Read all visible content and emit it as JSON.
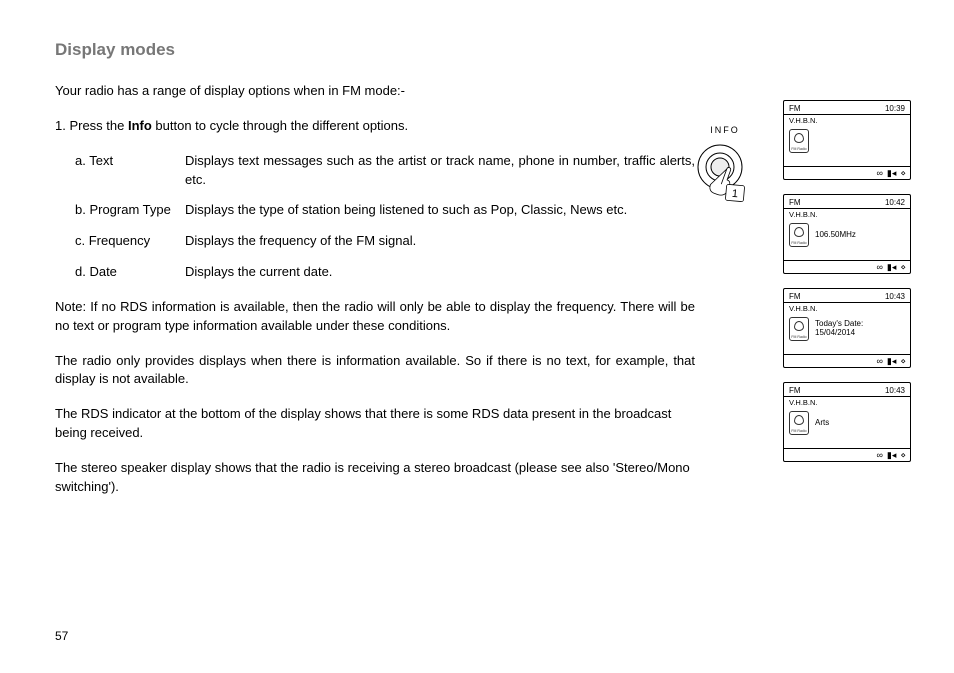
{
  "title": "Display modes",
  "intro": "Your radio has a range of display options when in FM mode:-",
  "instruction": {
    "prefix": "1. Press the ",
    "bold": "Info",
    "suffix": " button to cycle through the different options."
  },
  "options": [
    {
      "label": "a. Text",
      "desc": "Displays text messages such as the artist or track name, phone in number, traffic alerts, etc."
    },
    {
      "label": "b. Program Type",
      "desc": "Displays the type of station being listened to such as Pop, Classic, News etc."
    },
    {
      "label": "c. Frequency",
      "desc": "Displays the frequency of the FM signal."
    },
    {
      "label": "d. Date",
      "desc": "Displays the current date."
    }
  ],
  "notes": [
    "Note: If no RDS information is available, then the radio will only be able to display the frequency. There will be no text or program type information available under these conditions.",
    "The radio only provides displays when there is information available. So if there is no text, for example, that display is not available.",
    "The RDS indicator at the bottom of the display shows that there is some RDS data present in the broadcast being received.",
    "The stereo speaker display shows that the radio is receiving a stereo broadcast (please see also 'Stereo/Mono switching')."
  ],
  "dial": {
    "label": "INFO",
    "step": "1"
  },
  "screens": [
    {
      "mode": "FM",
      "time": "10:39",
      "station": "V.H.B.N.",
      "content_lines": [
        ""
      ]
    },
    {
      "mode": "FM",
      "time": "10:42",
      "station": "V.H.B.N.",
      "content_lines": [
        "106.50MHz"
      ]
    },
    {
      "mode": "FM",
      "time": "10:43",
      "station": "V.H.B.N.",
      "content_lines": [
        "Today's Date:",
        "15/04/2014"
      ]
    },
    {
      "mode": "FM",
      "time": "10:43",
      "station": "V.H.B.N.",
      "content_lines": [
        "Arts"
      ]
    }
  ],
  "page_number": "57"
}
